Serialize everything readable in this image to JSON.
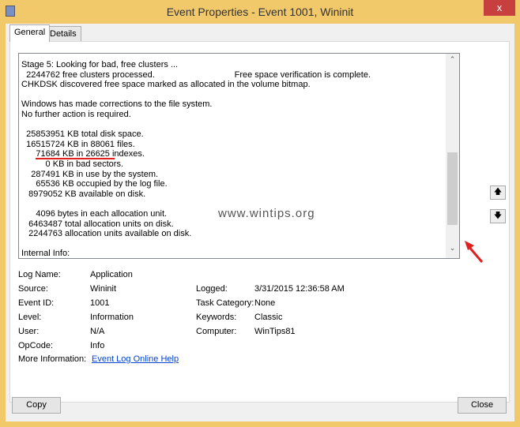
{
  "window": {
    "title": "Event Properties - Event 1001, Wininit",
    "close_label": "x"
  },
  "tabs": [
    {
      "label": "General"
    },
    {
      "label": "Details"
    }
  ],
  "description": "Stage 5: Looking for bad, free clusters ...\n  2244762 free clusters processed.                                 Free space verification is complete.\nCHKDSK discovered free space marked as allocated in the volume bitmap.\n\nWindows has made corrections to the file system.\nNo further action is required.\n\n  25853951 KB total disk space.\n  16515724 KB in 88061 files.\n      71684 KB in 26625 indexes.\n          0 KB in bad sectors.\n    287491 KB in use by the system.\n      65536 KB occupied by the log file.\n   8979052 KB available on disk.\n\n      4096 bytes in each allocation unit.\n   6463487 total allocation units on disk.\n   2244763 allocation units available on disk.\n\nInternal Info:",
  "watermark": "www.wintips.org",
  "fields": {
    "log_name": {
      "label": "Log Name:",
      "value": "Application"
    },
    "source": {
      "label": "Source:",
      "value": "Wininit"
    },
    "event_id": {
      "label": "Event ID:",
      "value": "1001"
    },
    "level": {
      "label": "Level:",
      "value": "Information"
    },
    "user": {
      "label": "User:",
      "value": "N/A"
    },
    "opcode": {
      "label": "OpCode:",
      "value": "Info"
    },
    "more_info": {
      "label": "More Information:",
      "value": "Event Log Online Help"
    },
    "logged": {
      "label": "Logged:",
      "value": "3/31/2015 12:36:58 AM"
    },
    "task_category": {
      "label": "Task Category:",
      "value": "None"
    },
    "keywords": {
      "label": "Keywords:",
      "value": "Classic"
    },
    "computer": {
      "label": "Computer:",
      "value": "WinTips81"
    }
  },
  "buttons": {
    "copy": "Copy",
    "close": "Close"
  },
  "colors": {
    "frame": "#f1c86a",
    "close": "#c7403f",
    "annotation": "#e02020"
  }
}
